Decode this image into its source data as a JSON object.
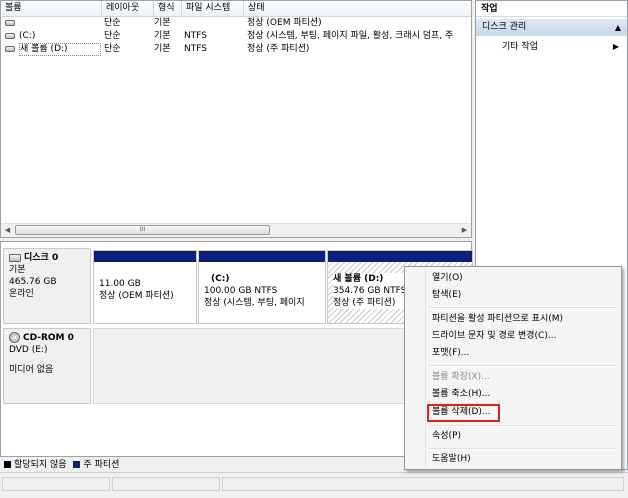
{
  "volume_list": {
    "columns": [
      "볼륨",
      "레이아웃",
      "형식",
      "파일 시스템",
      "상태"
    ],
    "rows": [
      {
        "volume": "",
        "layout": "단순",
        "type": "기본",
        "fs": "",
        "status": "정상 (OEM 파티션)"
      },
      {
        "volume": "(C:)",
        "layout": "단순",
        "type": "기본",
        "fs": "NTFS",
        "status": "정상 (시스템, 부팅, 페이지 파일, 활성, 크래시 덤프, 주"
      },
      {
        "volume": "새 볼륨 (D:)",
        "layout": "단순",
        "type": "기본",
        "fs": "NTFS",
        "status": "정상 (주 파티션)"
      }
    ],
    "scroll_thumb_glyph": "III"
  },
  "actions": {
    "title": "작업",
    "disk_management": "디스크 관리",
    "other_actions": "기타 작업",
    "collapse_glyph": "▲",
    "submenu_glyph": "▶"
  },
  "disk0": {
    "title": "디스크 0",
    "type": "기본",
    "size": "465.76 GB",
    "state": "온라인",
    "partitions": [
      {
        "name": "",
        "size": "11.00 GB",
        "status": "정상 (OEM 파티션)"
      },
      {
        "name": "(C:)",
        "size": "100.00 GB NTFS",
        "status": "정상 (시스템, 부팅, 페이지"
      },
      {
        "name": "새 볼륨 (D:)",
        "size": "354.76 GB NTFS",
        "status": "정상 (주 파티션)"
      }
    ]
  },
  "cdrom0": {
    "title": "CD-ROM 0",
    "type": "DVD (E:)",
    "state": "미디어 없음"
  },
  "legend": {
    "unallocated": "할당되지 않음",
    "primary": "주 파티션",
    "unallocated_color": "#000000",
    "primary_color": "#0b1f83"
  },
  "context_menu": {
    "open": "열기(O)",
    "explore": "탐색(E)",
    "mark_active": "파티션을 활성 파티션으로 표시(M)",
    "change_letter": "드라이브 문자 및 경로 변경(C)...",
    "format": "포맷(F)...",
    "extend": "볼륨 확장(X)...",
    "shrink": "볼륨 축소(H)...",
    "delete": "볼륨 삭제(D)...",
    "properties": "속성(P)",
    "help": "도움말(H)"
  },
  "highlight_color": "#e0201b"
}
